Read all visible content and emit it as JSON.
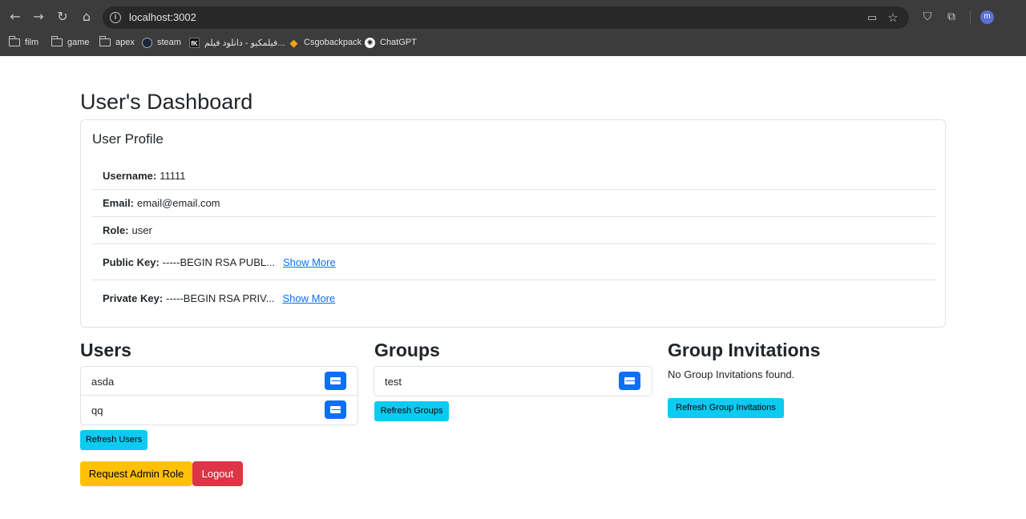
{
  "browser": {
    "url": "localhost:3002",
    "profile_initial": "m",
    "bookmarks": [
      {
        "label": "film",
        "icon": "folder-icon"
      },
      {
        "label": "game",
        "icon": "folder-icon"
      },
      {
        "label": "apex",
        "icon": "folder-icon"
      },
      {
        "label": "steam",
        "icon": "steam-icon"
      },
      {
        "label": "فیلمکیو - دانلود فیلم...",
        "icon": "filmkio-icon"
      },
      {
        "label": "Csgobackpack",
        "icon": "csgobackpack-icon"
      },
      {
        "label": "ChatGPT",
        "icon": "chatgpt-icon"
      }
    ]
  },
  "page_title": "User's Dashboard",
  "profile": {
    "title": "User Profile",
    "username_label": "Username:",
    "username": "11111",
    "email_label": "Email:",
    "email": "email@email.com",
    "role_label": "Role:",
    "role": "user",
    "public_key_label": "Public Key:",
    "public_key": "-----BEGIN RSA PUBL...",
    "private_key_label": "Private Key:",
    "private_key": "-----BEGIN RSA PRIV...",
    "show_more": "Show More"
  },
  "users": {
    "title": "Users",
    "items": [
      "asda",
      "qq"
    ],
    "refresh_label": "Refresh Users"
  },
  "groups": {
    "title": "Groups",
    "items": [
      "test"
    ],
    "refresh_label": "Refresh Groups"
  },
  "invitations": {
    "title": "Group Invitations",
    "empty_text": "No Group Invitations found.",
    "refresh_label": "Refresh Group Invitations"
  },
  "actions": {
    "request_admin_label": "Request Admin Role",
    "logout_label": "Logout"
  },
  "colors": {
    "primary": "#0d6efd",
    "info": "#0dcaf0",
    "warning": "#ffc107",
    "danger": "#dc3545",
    "chrome_bg": "#3c3c3c"
  }
}
